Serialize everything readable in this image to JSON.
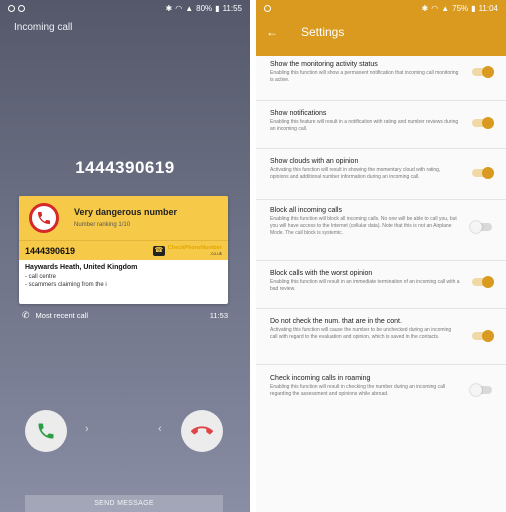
{
  "left": {
    "status": {
      "battery": "80%",
      "time": "11:55"
    },
    "screen_title": "Incoming call",
    "caller_number": "1444390619",
    "card": {
      "warning_title": "Very dangerous number",
      "ranking": "Number ranking 1/10",
      "number": "1444390619",
      "brand_name": "CheckPhoneNumber",
      "brand_domain": ".co.uk",
      "location": "Haywards Heath, United Kingdom",
      "details": [
        "- call centre",
        "- scammers claiming from the i"
      ]
    },
    "recent_label": "Most recent call",
    "recent_time": "11:53",
    "send_message": "SEND MESSAGE",
    "accent": {
      "accept": "#2e9e46",
      "decline": "#e04545",
      "card": "#f7c948"
    }
  },
  "right": {
    "status": {
      "battery": "75%",
      "time": "11:04"
    },
    "title": "Settings",
    "accent": "#d99a1f",
    "items": [
      {
        "title": "Show the monitoring activity status",
        "desc": "Enabling this function will show a permanent notification that incoming call monitoring is active.",
        "on": true
      },
      {
        "title": "Show notifications",
        "desc": "Enabling this feature will result in a notification with rating and number reviews during an incoming call.",
        "on": true
      },
      {
        "title": "Show clouds with an opinion",
        "desc": "Activating this function will result in showing the momentary cloud with rating, opinions and additional number information during an incoming call.",
        "on": true
      },
      {
        "title": "Block all incoming calls",
        "desc": "Enabling this function will block all incoming calls. No one will be able to call you, but you will have access to the Internet (cellular data). Note that this is not an Airplane Mode. The call block is systemic.",
        "on": false
      },
      {
        "title": "Block calls with the worst opinion",
        "desc": "Enabling this function will result in an immediate termination of an incoming call with a bad review.",
        "on": true
      },
      {
        "title": "Do not check the num. that are in the cont.",
        "desc": "Activating this function will cause the number to be unchecked during an incoming call with regard to the evaluation and opinion, which is saved in the contacts.",
        "on": true
      },
      {
        "title": "Check incoming calls in roaming",
        "desc": "Enabling this function will result in checking the number during an incoming call regarding the assessment and opinions while abroad.",
        "on": false
      }
    ]
  }
}
